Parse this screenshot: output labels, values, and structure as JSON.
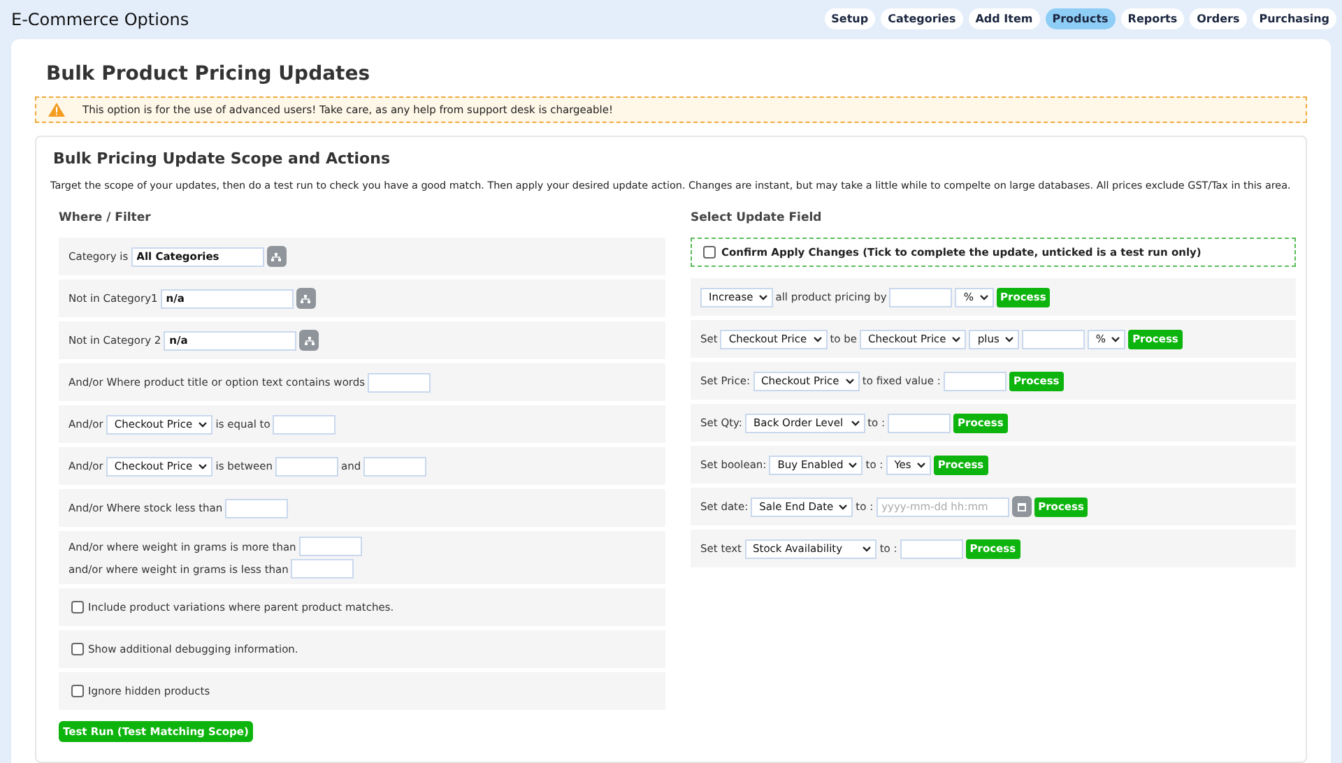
{
  "app_title": "E-Commerce Options",
  "nav": [
    {
      "label": "Setup",
      "selected": false
    },
    {
      "label": "Categories",
      "selected": false
    },
    {
      "label": "Add Item",
      "selected": false
    },
    {
      "label": "Products",
      "selected": true
    },
    {
      "label": "Reports",
      "selected": false
    },
    {
      "label": "Orders",
      "selected": false
    },
    {
      "label": "Purchasing",
      "selected": false
    }
  ],
  "page_title": "Bulk Product Pricing Updates",
  "warning": "This option is for the use of advanced users! Take care, as any help from support desk is chargeable!",
  "panel": {
    "title": "Bulk Pricing Update Scope and Actions",
    "description": "Target the scope of your updates, then do a test run to check you have a good match. Then apply your desired update action. Changes are instant, but may take a little while to compelte on large databases. All prices exclude GST/Tax in this area.",
    "filter": {
      "heading": "Where / Filter",
      "rows": [
        {
          "kind": "fields",
          "lines": [
            [
              {
                "kind": "text",
                "text": "Category is"
              },
              {
                "kind": "picker",
                "value": "All Categories"
              }
            ]
          ]
        },
        {
          "kind": "fields",
          "lines": [
            [
              {
                "kind": "text",
                "text": "Not in Category1"
              },
              {
                "kind": "picker",
                "value": "n/a"
              }
            ]
          ]
        },
        {
          "kind": "fields",
          "lines": [
            [
              {
                "kind": "text",
                "text": "Not in Category 2"
              },
              {
                "kind": "picker",
                "value": "n/a"
              }
            ]
          ]
        },
        {
          "kind": "fields",
          "lines": [
            [
              {
                "kind": "text",
                "text": "And/or Where product title or option text contains words"
              },
              {
                "kind": "input"
              }
            ]
          ]
        },
        {
          "kind": "fields",
          "lines": [
            [
              {
                "kind": "text",
                "text": "And/or"
              },
              {
                "kind": "select",
                "value": "Checkout Price"
              },
              {
                "kind": "text",
                "text": "is equal to"
              },
              {
                "kind": "input"
              }
            ]
          ]
        },
        {
          "kind": "fields",
          "lines": [
            [
              {
                "kind": "text",
                "text": "And/or"
              },
              {
                "kind": "select",
                "value": "Checkout Price"
              },
              {
                "kind": "text",
                "text": "is between"
              },
              {
                "kind": "input"
              },
              {
                "kind": "text",
                "text": "and"
              },
              {
                "kind": "input"
              }
            ]
          ]
        },
        {
          "kind": "fields",
          "lines": [
            [
              {
                "kind": "text",
                "text": "And/or Where stock less than"
              },
              {
                "kind": "input"
              }
            ]
          ]
        },
        {
          "kind": "fields",
          "lines": [
            [
              {
                "kind": "text",
                "text": "And/or where weight in grams is more than"
              },
              {
                "kind": "input"
              }
            ],
            [
              {
                "kind": "text",
                "text": "and/or where weight in grams is less than"
              },
              {
                "kind": "input"
              }
            ]
          ]
        },
        {
          "kind": "checkbox",
          "label": "Include product variations where parent product matches.",
          "checked": false
        },
        {
          "kind": "checkbox",
          "label": "Show additional debugging information.",
          "checked": false
        },
        {
          "kind": "checkbox",
          "label": "Ignore hidden products",
          "checked": false
        }
      ],
      "test_button": "Test Run (Test Matching Scope)"
    },
    "update": {
      "heading": "Select Update Field",
      "confirm": {
        "label": "Confirm Apply Changes (Tick to complete the update, unticked is a test run only)",
        "checked": false
      },
      "rows": [
        [
          {
            "kind": "select",
            "value": "Increase"
          },
          {
            "kind": "text",
            "text": "all product pricing by"
          },
          {
            "kind": "input"
          },
          {
            "kind": "select",
            "value": "%"
          },
          {
            "kind": "button",
            "text": "Process"
          }
        ],
        [
          {
            "kind": "text",
            "text": "Set"
          },
          {
            "kind": "select",
            "value": "Checkout Price"
          },
          {
            "kind": "text",
            "text": "to be"
          },
          {
            "kind": "select",
            "value": "Checkout Price"
          },
          {
            "kind": "select",
            "value": "plus"
          },
          {
            "kind": "input"
          },
          {
            "kind": "select",
            "value": "%"
          },
          {
            "kind": "button",
            "text": "Process"
          }
        ],
        [
          {
            "kind": "text",
            "text": "Set Price:"
          },
          {
            "kind": "select",
            "value": "Checkout Price"
          },
          {
            "kind": "text",
            "text": "to fixed value :"
          },
          {
            "kind": "input"
          },
          {
            "kind": "button",
            "text": "Process"
          }
        ],
        [
          {
            "kind": "text",
            "text": "Set Qty:"
          },
          {
            "kind": "select",
            "value": "Back Order Level"
          },
          {
            "kind": "text",
            "text": "to :"
          },
          {
            "kind": "input"
          },
          {
            "kind": "button",
            "text": "Process"
          }
        ],
        [
          {
            "kind": "text",
            "text": "Set boolean:"
          },
          {
            "kind": "select",
            "value": "Buy Enabled"
          },
          {
            "kind": "text",
            "text": "to :"
          },
          {
            "kind": "select",
            "value": "Yes"
          },
          {
            "kind": "button",
            "text": "Process"
          }
        ],
        [
          {
            "kind": "text",
            "text": "Set date:"
          },
          {
            "kind": "select",
            "value": "Sale End Date"
          },
          {
            "kind": "text",
            "text": "to :"
          },
          {
            "kind": "date",
            "placeholder": "yyyy-mm-dd hh:mm"
          },
          {
            "kind": "button",
            "text": "Process"
          }
        ],
        [
          {
            "kind": "text",
            "text": "Set text"
          },
          {
            "kind": "select",
            "value": "Stock Availability"
          },
          {
            "kind": "text",
            "text": "to :"
          },
          {
            "kind": "input"
          },
          {
            "kind": "button",
            "text": "Process"
          }
        ]
      ]
    }
  }
}
